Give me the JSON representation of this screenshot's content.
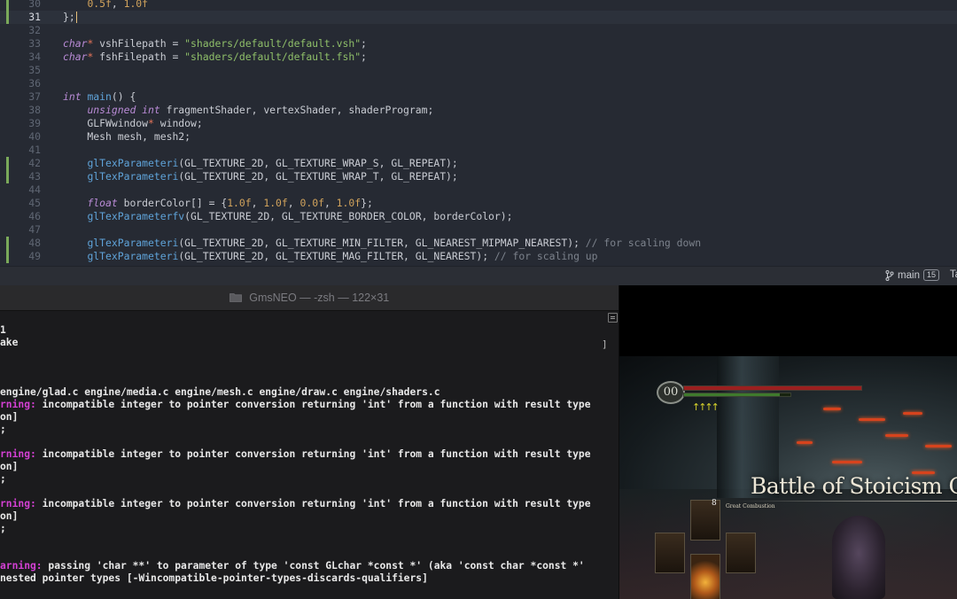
{
  "editor": {
    "lines": [
      {
        "n": "30",
        "html": "    <span class='num'>0.5f</span>, <span class='num'>1.0f</span>",
        "mark": true
      },
      {
        "n": "31",
        "html": "};",
        "mark": true,
        "current": true
      },
      {
        "n": "32",
        "html": ""
      },
      {
        "n": "33",
        "html": "<span class='kw'>char</span><span class='op'>*</span> vshFilepath = <span class='str'>\"shaders/default/default.vsh\"</span>;"
      },
      {
        "n": "34",
        "html": "<span class='kw'>char</span><span class='op'>*</span> fshFilepath = <span class='str'>\"shaders/default/default.fsh\"</span>;"
      },
      {
        "n": "35",
        "html": ""
      },
      {
        "n": "36",
        "html": ""
      },
      {
        "n": "37",
        "html": "<span class='kw'>int</span> <span class='fn'>main</span>() {"
      },
      {
        "n": "38",
        "html": "    <span class='kw'>unsigned int</span> fragmentShader, vertexShader, shaderProgram;"
      },
      {
        "n": "39",
        "html": "    GLFWwindow<span class='op'>*</span> window;"
      },
      {
        "n": "40",
        "html": "    Mesh mesh, mesh2;"
      },
      {
        "n": "41",
        "html": ""
      },
      {
        "n": "42",
        "html": "    <span class='fn'>glTexParameteri</span>(GL_TEXTURE_2D, GL_TEXTURE_WRAP_S, GL_REPEAT);",
        "mark": true
      },
      {
        "n": "43",
        "html": "    <span class='fn'>glTexParameteri</span>(GL_TEXTURE_2D, GL_TEXTURE_WRAP_T, GL_REPEAT);",
        "mark": true
      },
      {
        "n": "44",
        "html": ""
      },
      {
        "n": "45",
        "html": "    <span class='kw'>float</span> borderColor[] = {<span class='num'>1.0f</span>, <span class='num'>1.0f</span>, <span class='num'>0.0f</span>, <span class='num'>1.0f</span>};"
      },
      {
        "n": "46",
        "html": "    <span class='fn'>glTexParameterfv</span>(GL_TEXTURE_2D, GL_TEXTURE_BORDER_COLOR, borderColor);"
      },
      {
        "n": "47",
        "html": ""
      },
      {
        "n": "48",
        "html": "    <span class='fn'>glTexParameteri</span>(GL_TEXTURE_2D, GL_TEXTURE_MIN_FILTER, GL_NEAREST_MIPMAP_NEAREST); <span class='cm'>// for scaling down</span>",
        "mark": true
      },
      {
        "n": "49",
        "html": "    <span class='fn'>glTexParameteri</span>(GL_TEXTURE_2D, GL_TEXTURE_MAG_FILTER, GL_NEAREST); <span class='cm'>// for scaling up</span>",
        "mark": true
      }
    ]
  },
  "statusbar": {
    "branch": "main",
    "badge": "15",
    "truncated": "Ta"
  },
  "terminal": {
    "title": "GmsNEO — -zsh — 122×31",
    "lines": [
      {
        "text": "",
        "warn_prefix": ""
      },
      {
        "text": "1",
        "warn_prefix": ""
      },
      {
        "text": "ake",
        "warn_prefix": ""
      },
      {
        "text": "",
        "warn_prefix": ""
      },
      {
        "text": "",
        "warn_prefix": ""
      },
      {
        "text": "",
        "warn_prefix": ""
      },
      {
        "text": "engine/glad.c engine/media.c engine/mesh.c engine/draw.c engine/shaders.c",
        "warn_prefix": ""
      },
      {
        "text": " incompatible integer to pointer conversion returning 'int' from a function with result type",
        "warn_prefix": "rning:"
      },
      {
        "text": "on]",
        "warn_prefix": ""
      },
      {
        "text": ";",
        "warn_prefix": ""
      },
      {
        "text": "",
        "warn_prefix": ""
      },
      {
        "text": " incompatible integer to pointer conversion returning 'int' from a function with result type",
        "warn_prefix": "rning:"
      },
      {
        "text": "on]",
        "warn_prefix": ""
      },
      {
        "text": ";",
        "warn_prefix": ""
      },
      {
        "text": "",
        "warn_prefix": ""
      },
      {
        "text": " incompatible integer to pointer conversion returning 'int' from a function with result type",
        "warn_prefix": "rning:"
      },
      {
        "text": "on]",
        "warn_prefix": ""
      },
      {
        "text": ";",
        "warn_prefix": ""
      },
      {
        "text": "",
        "warn_prefix": ""
      },
      {
        "text": "",
        "warn_prefix": ""
      },
      {
        "text": " passing 'char **' to parameter of type 'const GLchar *const *' (aka 'const char *const *'",
        "warn_prefix": "arning:"
      },
      {
        "text": "nested pointer types [-Wincompatible-pointer-types-discards-qualifiers]",
        "warn_prefix": ""
      }
    ],
    "cursor_glyph": "]"
  },
  "game": {
    "area_name": "Battle of Stoicism Gazeb",
    "level": "00",
    "hp_fraction": 1.0,
    "stamina_fraction": 0.9,
    "buff_icon": "↑↑↑↑",
    "item_count": "8",
    "item_label": "Great Combustion"
  }
}
